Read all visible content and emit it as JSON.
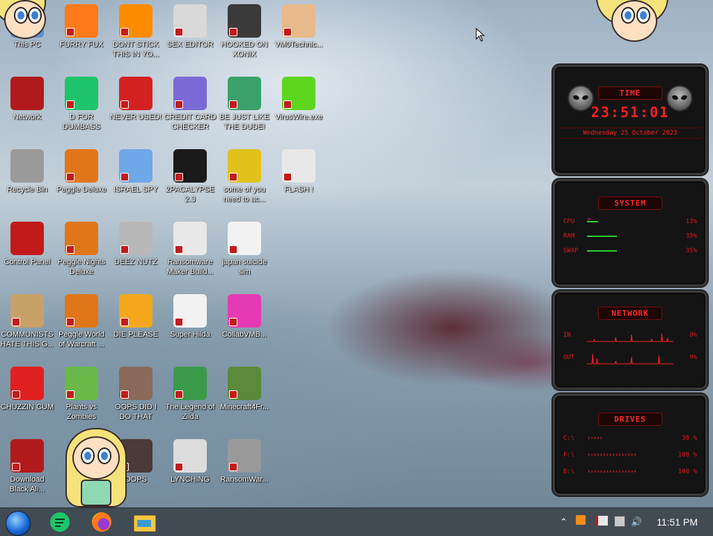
{
  "desktop": {
    "icons": [
      {
        "label": "This PC",
        "icon": "this-pc-icon",
        "color": "#5a8fd6"
      },
      {
        "label": "FURRY FUX",
        "icon": "firefox-icon",
        "color": "#ff7a1a"
      },
      {
        "label": "DONT STICK THIS IN YO...",
        "icon": "vlc-cone-icon",
        "color": "#ff8c00"
      },
      {
        "label": "SEX EDITOR",
        "icon": "hxd-editor-icon",
        "color": "#d9d9d9"
      },
      {
        "label": "HOOKED ON XONIX",
        "icon": "xonix-icon",
        "color": "#3a3a3a"
      },
      {
        "label": "VM0Technic...",
        "icon": "doctor-icon",
        "color": "#e8b98a"
      },
      {
        "label": "Network",
        "icon": "alien-network-icon",
        "color": "#b01a1a"
      },
      {
        "label": "D FOR DUMBASS",
        "icon": "chat-bubble-icon",
        "color": "#1ec46a"
      },
      {
        "label": "NEVER USED!",
        "icon": "devcpp-icon",
        "color": "#d42020"
      },
      {
        "label": "CREDIT CARD CHECKER",
        "icon": "credit-card-icon",
        "color": "#7b6ad6"
      },
      {
        "label": "BE JUST LIKE THE DUDE!",
        "icon": "santa-icon",
        "color": "#3aa16a"
      },
      {
        "label": "VirusWire.exe",
        "icon": "lime-icon",
        "color": "#5ed61e"
      },
      {
        "label": "Recycle Bin",
        "icon": "recycle-bin-icon",
        "color": "#9a9a9a"
      },
      {
        "label": "Peggle Deluxe",
        "icon": "peggle-icon",
        "color": "#e0761a"
      },
      {
        "label": "ISRAEL SPY",
        "icon": "spy-network-icon",
        "color": "#6fa8e8"
      },
      {
        "label": "2PACALYPSE 2.3",
        "icon": "terminal-icon",
        "color": "#1a1a1a"
      },
      {
        "label": "some of you need to ac...",
        "icon": "bear-icon",
        "color": "#e0c21a"
      },
      {
        "label": "FLASH !",
        "icon": "flash-icon",
        "color": "#e8e8e8"
      },
      {
        "label": "Control Panel",
        "icon": "control-panel-icon",
        "color": "#c21a1a"
      },
      {
        "label": "Peggle Nights Deluxe",
        "icon": "peggle-nights-icon",
        "color": "#e0761a"
      },
      {
        "label": "DEEZ NUTZ",
        "icon": "windows-stack-icon",
        "color": "#b8b8b8"
      },
      {
        "label": "Ransomware Maker Build...",
        "icon": "window-app-icon",
        "color": "#e8e8e8"
      },
      {
        "label": "japan suicide sim",
        "icon": "japan-sim-icon",
        "color": "#f2f2f2"
      },
      {
        "label": "COMMUNISTS HATE THIS G...",
        "icon": "money-bag-icon",
        "color": "#c8a06a"
      },
      {
        "label": "Peggle World of Warcraft ...",
        "icon": "peggle-wow-icon",
        "color": "#e0761a"
      },
      {
        "label": "DIE PLEASE",
        "icon": "de-icon",
        "color": "#f2a81a"
      },
      {
        "label": "Super Hilda",
        "icon": "pixel-character-icon",
        "color": "#f2f2f2"
      },
      {
        "label": "CollabVMB...",
        "icon": "pink-monitor-icon",
        "color": "#e63ab4"
      },
      {
        "label": "CHUZZIN CUM",
        "icon": "chuzzle-icon",
        "color": "#e02020"
      },
      {
        "label": "Plants vs Zombies",
        "icon": "plant-icon",
        "color": "#6ab84a"
      },
      {
        "label": "OOPS DID I DO THAT",
        "icon": "portrait-icon",
        "color": "#8a6a5a"
      },
      {
        "label": "The Legend of Zilda",
        "icon": "pixel-hero-icon",
        "color": "#3a9a4a"
      },
      {
        "label": "Minecraft4Fr...",
        "icon": "minecraft-block-icon",
        "color": "#5a8a3a"
      },
      {
        "label": "Download Black Ali...",
        "icon": "alien-download-icon",
        "color": "#b01a1a"
      },
      {
        "label": "OOPS",
        "icon": "dark-monitor-icon",
        "color": "#4a3a3a"
      },
      {
        "label": "LYNCHING",
        "icon": "noose-icon",
        "color": "#dcdcdc"
      },
      {
        "label": "RansomWar...",
        "icon": "skull-icon",
        "color": "#9a9a9a"
      }
    ]
  },
  "widget": {
    "time_title": "TIME",
    "time": "23:51:01",
    "date": "Wednesday 25 October 2023",
    "system_title": "SYSTEM",
    "system_rows": [
      {
        "label": "CPU",
        "value": "13%",
        "level": 0.13
      },
      {
        "label": "RAM",
        "value": "35%",
        "level": 0.35
      },
      {
        "label": "SWAP",
        "value": "35%",
        "level": 0.35
      }
    ],
    "network_title": "NETWORK",
    "network_rows": [
      {
        "label": "IN",
        "value": "0%"
      },
      {
        "label": "OUT",
        "value": "0%"
      }
    ],
    "drives_title": "DRIVES",
    "drive_rows": [
      {
        "label": "C:\\",
        "value": "30 %",
        "level": 0.3
      },
      {
        "label": "F:\\",
        "value": "100 %",
        "level": 1.0
      },
      {
        "label": "E:\\",
        "value": "100 %",
        "level": 1.0
      }
    ],
    "accent": "#ff2020"
  },
  "taskbar": {
    "clock": "11:51 PM",
    "apps": [
      {
        "icon": "start-orb-icon"
      },
      {
        "icon": "chat-app-icon"
      },
      {
        "icon": "firefox-icon"
      },
      {
        "icon": "file-explorer-icon"
      }
    ],
    "tray": [
      "show-hidden-icons-chevron",
      "notification-icon",
      "flag-icon",
      "network-icon",
      "volume-icon"
    ]
  }
}
